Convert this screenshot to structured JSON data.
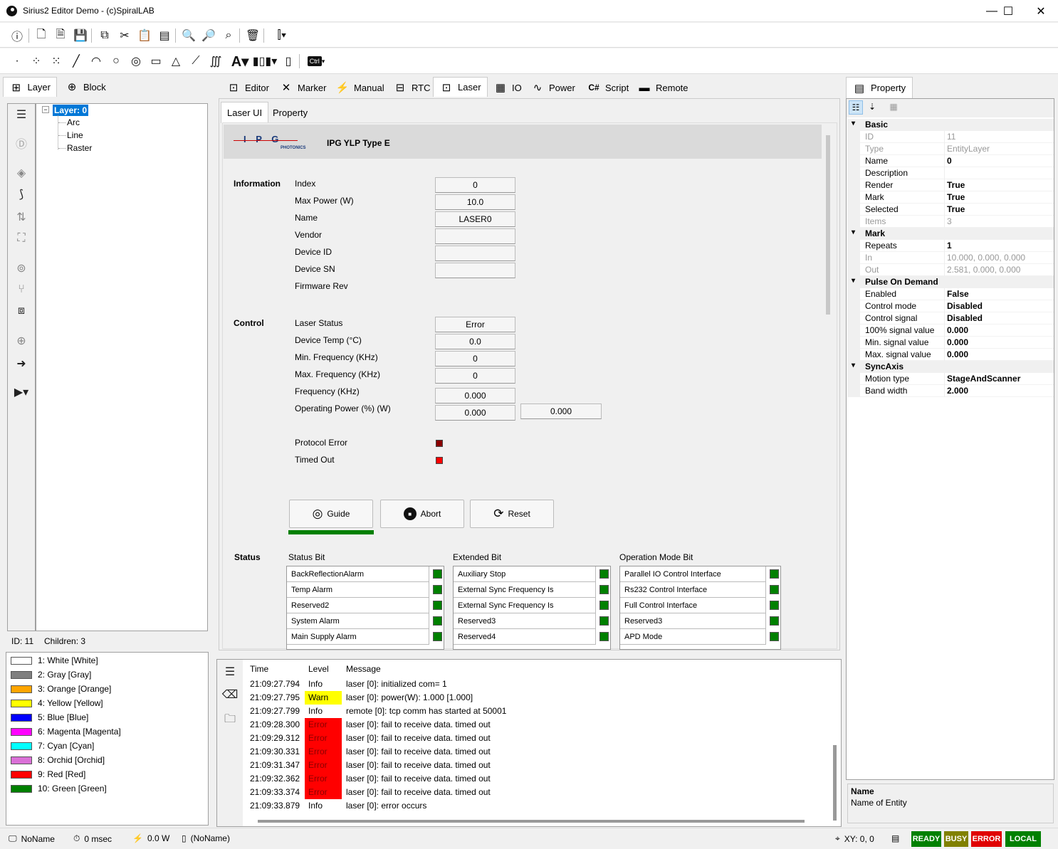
{
  "window": {
    "title": "Sirius2 Editor Demo - (c)SpiralLAB",
    "minimize": "—",
    "maximize": "☐",
    "close": "✕"
  },
  "left_tabs": {
    "layer": "Layer",
    "block": "Block"
  },
  "tree": {
    "root": "Layer: 0",
    "children": [
      "Arc",
      "Line",
      "Raster"
    ]
  },
  "tree_status": {
    "id": "ID: 11",
    "children": "Children: 3"
  },
  "pens": [
    {
      "label": "1: White [White]",
      "color": "#ffffff"
    },
    {
      "label": "2: Gray [Gray]",
      "color": "#808080"
    },
    {
      "label": "3: Orange [Orange]",
      "color": "#ffa500"
    },
    {
      "label": "4: Yellow [Yellow]",
      "color": "#ffff00"
    },
    {
      "label": "5: Blue [Blue]",
      "color": "#0000ff"
    },
    {
      "label": "6: Magenta [Magenta]",
      "color": "#ff00ff"
    },
    {
      "label": "7: Cyan [Cyan]",
      "color": "#00ffff"
    },
    {
      "label": "8: Orchid [Orchid]",
      "color": "#da70d6"
    },
    {
      "label": "9: Red [Red]",
      "color": "#ff0000"
    },
    {
      "label": "10: Green [Green]",
      "color": "#008000"
    }
  ],
  "main_tabs": [
    "Editor",
    "Marker",
    "Manual",
    "RTC",
    "Laser",
    "IO",
    "Power",
    "Script",
    "Remote"
  ],
  "sub_tabs": {
    "laser_ui": "Laser UI",
    "property": "Property"
  },
  "laser": {
    "logo_text": "I P G",
    "logo_sub": "PHOTONICS",
    "model": "IPG YLP Type E",
    "information_heading": "Information",
    "info_labels": [
      "Index",
      "Max Power (W)",
      "Name",
      "Vendor",
      "Device ID",
      "Device SN",
      "Firmware Rev"
    ],
    "info_values": [
      "0",
      "10.0",
      "LASER0",
      "",
      "",
      ""
    ],
    "control_heading": "Control",
    "control_labels": [
      "Laser Status",
      "Device Temp (°C)",
      "Min. Frequency (KHz)",
      "Max. Frequency (KHz)",
      "Frequency (KHz)",
      "Operating Power (%) (W)"
    ],
    "control_values": [
      "Error",
      "0.0",
      "0",
      "0",
      "0.000",
      "0.000"
    ],
    "operating_power_w": "0.000",
    "protocol_error": "Protocol Error",
    "timed_out": "Timed Out",
    "buttons": {
      "guide": "Guide",
      "abort": "Abort",
      "reset": "Reset"
    },
    "status_heading": "Status",
    "status_bit_heading": "Status Bit",
    "extended_bit_heading": "Extended Bit",
    "operation_mode_heading": "Operation Mode Bit",
    "status_bits": [
      "BackReflectionAlarm",
      "Temp Alarm",
      "Reserved2",
      "System Alarm",
      "Main Supply Alarm"
    ],
    "extended_bits": [
      "Auxiliary Stop",
      "External Sync Frequency Is",
      "External Sync Frequency Is",
      "Reserved3",
      "Reserved4"
    ],
    "operation_bits": [
      "Parallel IO Control Interface",
      "Rs232 Control Interface",
      "Full Control Interface",
      "Reserved3",
      "APD Mode"
    ]
  },
  "property_panel": {
    "tab": "Property",
    "categories": [
      {
        "name": "Basic",
        "rows": [
          {
            "k": "ID",
            "v": "11",
            "bold": false,
            "gray": true
          },
          {
            "k": "Type",
            "v": "EntityLayer",
            "bold": false,
            "gray": true
          },
          {
            "k": "Name",
            "v": "0",
            "bold": true,
            "gray": false
          },
          {
            "k": "Description",
            "v": "",
            "bold": false,
            "gray": false
          },
          {
            "k": "Render",
            "v": "True",
            "bold": true,
            "gray": false
          },
          {
            "k": "Mark",
            "v": "True",
            "bold": true,
            "gray": false
          },
          {
            "k": "Selected",
            "v": "True",
            "bold": true,
            "gray": false
          },
          {
            "k": "Items",
            "v": "3",
            "bold": false,
            "gray": true
          }
        ]
      },
      {
        "name": "Mark",
        "rows": [
          {
            "k": "Repeats",
            "v": "1",
            "bold": true,
            "gray": false
          },
          {
            "k": "In",
            "v": "10.000, 0.000, 0.000",
            "bold": false,
            "gray": true
          },
          {
            "k": "Out",
            "v": "2.581, 0.000, 0.000",
            "bold": false,
            "gray": true
          }
        ]
      },
      {
        "name": "Pulse On Demand",
        "rows": [
          {
            "k": "Enabled",
            "v": "False",
            "bold": true,
            "gray": false
          },
          {
            "k": "Control mode",
            "v": "Disabled",
            "bold": true,
            "gray": false
          },
          {
            "k": "Control signal",
            "v": "Disabled",
            "bold": true,
            "gray": false
          },
          {
            "k": "100% signal value",
            "v": "0.000",
            "bold": true,
            "gray": false
          },
          {
            "k": "Min. signal value",
            "v": "0.000",
            "bold": true,
            "gray": false
          },
          {
            "k": "Max. signal value",
            "v": "0.000",
            "bold": true,
            "gray": false
          }
        ]
      },
      {
        "name": "SyncAxis",
        "rows": [
          {
            "k": "Motion type",
            "v": "StageAndScanner",
            "bold": true,
            "gray": false
          },
          {
            "k": "Band width",
            "v": "2.000",
            "bold": true,
            "gray": false
          }
        ]
      }
    ],
    "desc_title": "Name",
    "desc_text": "Name of Entity"
  },
  "log": {
    "headers": {
      "time": "Time",
      "level": "Level",
      "message": "Message"
    },
    "rows": [
      {
        "time": "21:09:27.794",
        "level": "Info",
        "msg": "laser [0]: initialized com= 1"
      },
      {
        "time": "21:09:27.795",
        "level": "Warn",
        "msg": "laser [0]: power(W): 1.000 [1.000]"
      },
      {
        "time": "21:09:27.799",
        "level": "Info",
        "msg": "remote [0]: tcp comm has started at 50001"
      },
      {
        "time": "21:09:28.300",
        "level": "Error",
        "msg": "laser [0]: fail to receive data. timed out"
      },
      {
        "time": "21:09:29.312",
        "level": "Error",
        "msg": "laser [0]: fail to receive data. timed out"
      },
      {
        "time": "21:09:30.331",
        "level": "Error",
        "msg": "laser [0]: fail to receive data. timed out"
      },
      {
        "time": "21:09:31.347",
        "level": "Error",
        "msg": "laser [0]: fail to receive data. timed out"
      },
      {
        "time": "21:09:32.362",
        "level": "Error",
        "msg": "laser [0]: fail to receive data. timed out"
      },
      {
        "time": "21:09:33.374",
        "level": "Error",
        "msg": "laser [0]: fail to receive data. timed out"
      },
      {
        "time": "21:09:33.879",
        "level": "Info",
        "msg": "laser [0]: error occurs"
      }
    ]
  },
  "statusbar": {
    "name": "NoName",
    "time": "0 msec",
    "power": "0.0 W",
    "doc": "(NoName)",
    "xy": "XY: 0, 0",
    "ready": "READY",
    "busy": "BUSY",
    "error": "ERROR",
    "local": "LOCAL"
  },
  "colors": {
    "accent": "#0078d7",
    "ready": "#008000",
    "busy": "#808000",
    "error": "#e00000",
    "local": "#008000",
    "warn": "#ffff00",
    "error_cell": "#ff0000"
  }
}
